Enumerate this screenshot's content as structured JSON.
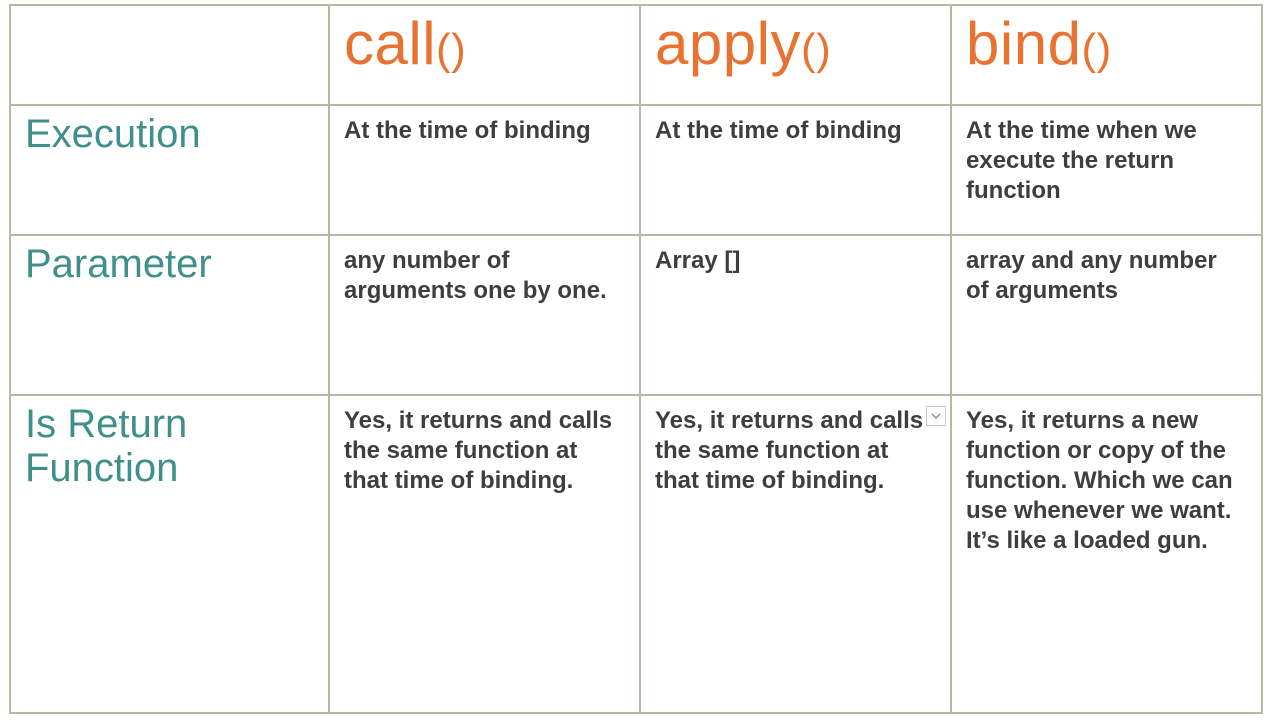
{
  "columns": {
    "call": {
      "name": "call",
      "parens": "()"
    },
    "apply": {
      "name": "apply",
      "parens": "()"
    },
    "bind": {
      "name": "bind",
      "parens": "()"
    }
  },
  "rows": {
    "execution": {
      "label": "Execution",
      "call": "At the time of binding",
      "apply": "At the time of binding",
      "bind": "At the time when we execute the return function"
    },
    "parameter": {
      "label": "Parameter",
      "call": "any number of arguments one by one.",
      "apply": "Array []",
      "bind": "array and any number of arguments"
    },
    "return": {
      "label": "Is Return Function",
      "call": "Yes, it returns and calls the same function at that time of binding.",
      "apply": "Yes, it returns and calls the same function at that time of binding.",
      "bind": "Yes, it returns a new function or copy of the function. Which we can use whenever we want. It’s like a loaded gun."
    }
  }
}
